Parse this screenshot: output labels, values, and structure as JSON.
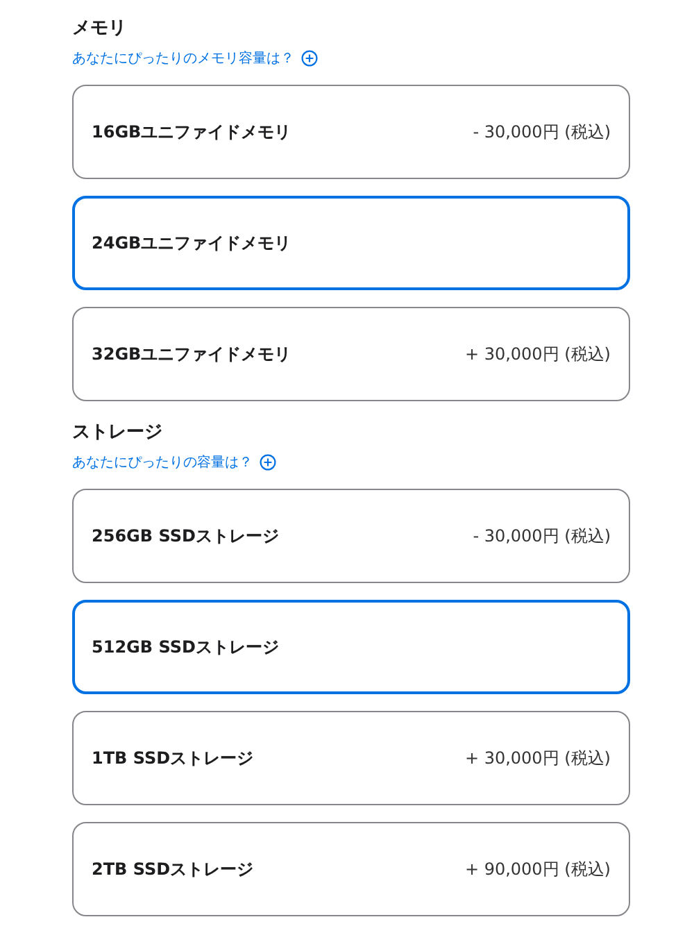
{
  "sections": [
    {
      "title": "メモリ",
      "help_link": "あなたにぴったりのメモリ容量は？",
      "options": [
        {
          "label": "16GBユニファイドメモリ",
          "price": "- 30,000円 (税込)",
          "selected": false
        },
        {
          "label": "24GBユニファイドメモリ",
          "selected": true
        },
        {
          "label": "32GBユニファイドメモリ",
          "price": "+ 30,000円 (税込)",
          "selected": false
        }
      ]
    },
    {
      "title": "ストレージ",
      "help_link": "あなたにぴったりの容量は？",
      "options": [
        {
          "label": "256GB SSDストレージ",
          "price": "- 30,000円 (税込)",
          "selected": false
        },
        {
          "label": "512GB SSDストレージ",
          "selected": true
        },
        {
          "label": "1TB SSDストレージ",
          "price": "+ 30,000円 (税込)",
          "selected": false
        },
        {
          "label": "2TB SSDストレージ",
          "price": "+ 90,000円 (税込)",
          "selected": false
        }
      ]
    }
  ]
}
